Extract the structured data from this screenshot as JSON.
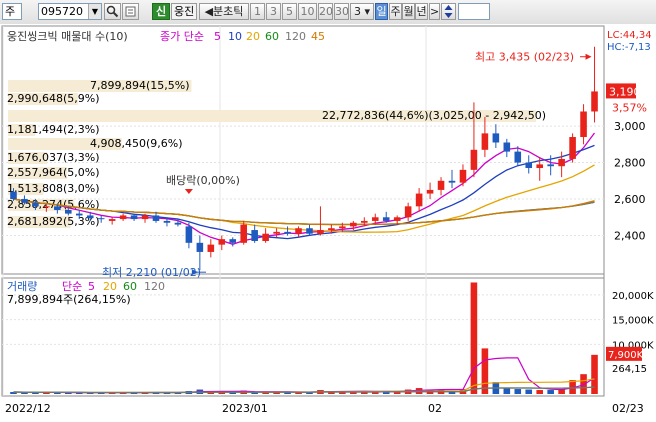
{
  "toolbar": {
    "market": "주",
    "code": "095720",
    "search_icon": "magnifier-icon",
    "new_label": "신",
    "stock_name": "웅진",
    "period_label": "분초틱",
    "intervals": [
      "1",
      "3",
      "5",
      "10",
      "20",
      "30"
    ],
    "count_value": "3",
    "period_day": "일",
    "period_week": "주",
    "period_month": "월",
    "period_year": "년",
    "next_label": ">",
    "toggle_icon": "up-down-arrows-icon"
  },
  "price_panel": {
    "title": "웅진씽크빅 매물대 수(10)",
    "ma_title": "종가 단순",
    "ma_periods": [
      "5",
      "10",
      "20",
      "60",
      "120",
      "45"
    ],
    "ma_colors": [
      "#cc00cc",
      "#1f3fbf",
      "#e6a400",
      "#178a17",
      "#777777",
      "#d17a00"
    ],
    "lc_label": "LC:44,34",
    "hc_label": "HC:-7,13",
    "high_label": "최고 3,435 (02/23)",
    "low_label": "최저 2,210 (01/02)",
    "dividend_label": "배당락(0,00%)",
    "last_price": "3,190",
    "last_change": "3,57%",
    "volume_profile": [
      {
        "text": "7,899,894(15,5%)",
        "pct": 15.5
      },
      {
        "text": "2,990,648(5,9%)",
        "pct": 5.9
      },
      {
        "text": "22,772,836(44,6%)(3,025,00 - 2,942,50)",
        "pct": 44.6
      },
      {
        "text": "1,181,494(2,3%)",
        "pct": 2.3
      },
      {
        "text": "4,908,450(9,6%)",
        "pct": 9.6
      },
      {
        "text": "1,676,037(3,3%)",
        "pct": 3.3
      },
      {
        "text": "2,557,964(5,0%)",
        "pct": 5.0
      },
      {
        "text": "1,513,808(3,0%)",
        "pct": 3.0
      },
      {
        "text": "2,858,274(5,6%)",
        "pct": 5.6
      },
      {
        "text": "2,681,892(5,3%)",
        "pct": 5.3
      }
    ]
  },
  "price_axis": [
    "3,000",
    "2,800",
    "2,600",
    "2,400"
  ],
  "volume_panel": {
    "title": "거래량",
    "ma_title": "단순",
    "ma_periods": [
      "5",
      "20",
      "60",
      "120"
    ],
    "ma_colors": [
      "#cc00cc",
      "#e6a400",
      "#178a17",
      "#777777"
    ],
    "info": "7,899,894주(264,15%)",
    "last_volume": "7,900K",
    "last_pct": "264,15"
  },
  "volume_axis": [
    "20,000K",
    "15,000K",
    "10,000K"
  ],
  "date_axis": [
    "2022/12",
    "2023/01",
    "02",
    "02/23"
  ],
  "colors": {
    "up": "#e8231b",
    "down": "#1f5bbf"
  },
  "chart_data": {
    "type": "candlestick",
    "title": "웅진씽크빅 매물대 수(10)",
    "price_ylim": [
      2200,
      3450
    ],
    "high": {
      "value": 3435,
      "date": "02/23"
    },
    "low": {
      "value": 2210,
      "date": "01/02"
    },
    "candles": [
      [
        2640,
        2660,
        2590,
        2600
      ],
      [
        2600,
        2620,
        2570,
        2580
      ],
      [
        2580,
        2600,
        2540,
        2560
      ],
      [
        2560,
        2570,
        2530,
        2560
      ],
      [
        2560,
        2570,
        2520,
        2540
      ],
      [
        2540,
        2560,
        2510,
        2520
      ],
      [
        2520,
        2540,
        2490,
        2510
      ],
      [
        2510,
        2530,
        2480,
        2495
      ],
      [
        2495,
        2510,
        2470,
        2490
      ],
      [
        2480,
        2500,
        2460,
        2490
      ],
      [
        2490,
        2520,
        2480,
        2510
      ],
      [
        2510,
        2520,
        2480,
        2490
      ],
      [
        2490,
        2520,
        2470,
        2510
      ],
      [
        2510,
        2530,
        2470,
        2480
      ],
      [
        2480,
        2500,
        2450,
        2470
      ],
      [
        2470,
        2490,
        2450,
        2460
      ],
      [
        2450,
        2470,
        2330,
        2360
      ],
      [
        2360,
        2400,
        2210,
        2310
      ],
      [
        2310,
        2380,
        2280,
        2350
      ],
      [
        2350,
        2400,
        2320,
        2380
      ],
      [
        2380,
        2390,
        2340,
        2360
      ],
      [
        2360,
        2480,
        2350,
        2460
      ],
      [
        2430,
        2460,
        2360,
        2370
      ],
      [
        2370,
        2440,
        2360,
        2410
      ],
      [
        2410,
        2440,
        2390,
        2420
      ],
      [
        2420,
        2450,
        2400,
        2410
      ],
      [
        2410,
        2450,
        2390,
        2440
      ],
      [
        2440,
        2460,
        2400,
        2410
      ],
      [
        2410,
        2560,
        2400,
        2430
      ],
      [
        2430,
        2460,
        2410,
        2440
      ],
      [
        2440,
        2470,
        2420,
        2450
      ],
      [
        2450,
        2480,
        2430,
        2470
      ],
      [
        2470,
        2500,
        2450,
        2480
      ],
      [
        2480,
        2520,
        2460,
        2500
      ],
      [
        2500,
        2530,
        2470,
        2480
      ],
      [
        2480,
        2510,
        2460,
        2500
      ],
      [
        2500,
        2580,
        2480,
        2560
      ],
      [
        2560,
        2660,
        2530,
        2630
      ],
      [
        2630,
        2690,
        2600,
        2650
      ],
      [
        2650,
        2720,
        2620,
        2700
      ],
      [
        2700,
        2760,
        2660,
        2690
      ],
      [
        2690,
        2790,
        2670,
        2760
      ],
      [
        2760,
        3130,
        2720,
        2870
      ],
      [
        2870,
        3050,
        2830,
        2960
      ],
      [
        2960,
        3010,
        2880,
        2910
      ],
      [
        2910,
        2930,
        2830,
        2860
      ],
      [
        2860,
        2890,
        2780,
        2800
      ],
      [
        2800,
        2840,
        2740,
        2770
      ],
      [
        2770,
        2830,
        2700,
        2790
      ],
      [
        2790,
        2840,
        2730,
        2780
      ],
      [
        2780,
        2860,
        2720,
        2820
      ],
      [
        2820,
        2960,
        2800,
        2940
      ],
      [
        2940,
        3120,
        2900,
        3080
      ],
      [
        3080,
        3435,
        3020,
        3190
      ]
    ],
    "volume_ylim": [
      0,
      23000000
    ],
    "volume": [
      400000,
      350000,
      300000,
      320000,
      280000,
      300000,
      260000,
      280000,
      300000,
      250000,
      320000,
      280000,
      300000,
      350000,
      280000,
      260000,
      600000,
      900000,
      500000,
      400000,
      350000,
      700000,
      500000,
      400000,
      350000,
      380000,
      400000,
      350000,
      800000,
      500000,
      450000,
      500000,
      600000,
      550000,
      500000,
      600000,
      900000,
      1200000,
      800000,
      900000,
      700000,
      1000000,
      22500000,
      9200000,
      2400000,
      1300000,
      1000000,
      900000,
      800000,
      800000,
      900000,
      2800000,
      4000000,
      7900000
    ]
  }
}
